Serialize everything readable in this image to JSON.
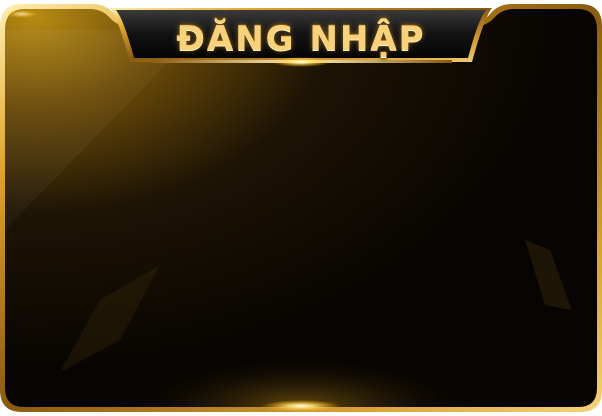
{
  "dialog": {
    "title": "ĐĂNG NHẬP"
  },
  "colors": {
    "gold_light": "#ffe9a6",
    "gold": "#e2a92c",
    "gold_dark": "#8a5a0e",
    "panel_dark": "#0b0703",
    "title_text": "#f7d27a"
  }
}
